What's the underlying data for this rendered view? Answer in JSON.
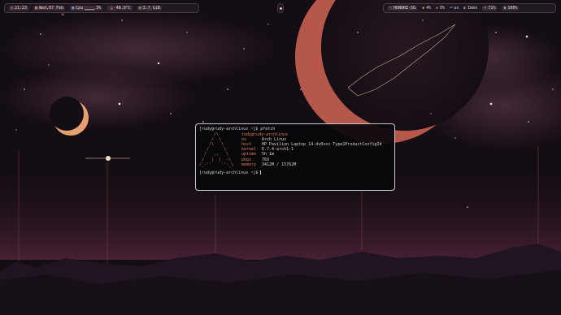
{
  "topbar": {
    "left": {
      "time": "21:23",
      "date": "Wed,07 Feb",
      "cpu_label": "Cpu",
      "cpu_graph": "▁▁▁▁",
      "cpu_percent": "3%",
      "temp": "48.0°C",
      "mem": "3.7 GiB"
    },
    "right": {
      "network": "HONORE-5G",
      "cpu_small": "4%",
      "mem_small": "0%",
      "keyboard": "us",
      "mode": "Immo",
      "brightness": "71%",
      "battery": "100%"
    }
  },
  "icons": {
    "clock": "clock-icon",
    "calendar": "calendar-icon",
    "cpu": "cpu-icon",
    "temperature": "thermometer-icon",
    "memory": "memory-icon",
    "wifi": "wifi-icon",
    "battery": "battery-icon"
  },
  "close_glyph": "×",
  "terminal": {
    "prompt1": "[rudy@rudy-archlinux ~]$ pfetch",
    "logo": "      /\\\n     /  \\\n    /\\   \\\n   /      \\\n  /   ,,   \\\n /   |  |  -\\\n/_-''    ''-_\\",
    "header": "rudy@rudy-archlinux",
    "rows": [
      {
        "key": "os",
        "value": "Arch Linux"
      },
      {
        "key": "host",
        "value": "HP Pavilion Laptop 14-dv0xxx Type1ProductConfigId"
      },
      {
        "key": "kernel",
        "value": "6.7.4-arch1-1"
      },
      {
        "key": "uptime",
        "value": "5h 1m"
      },
      {
        "key": "pkgs",
        "value": "769"
      },
      {
        "key": "memory",
        "value": "3412M / 15762M"
      }
    ],
    "prompt2": "[rudy@rudy-archlinux ~]$ "
  },
  "colors": {
    "sky": "#140d13",
    "mountain": "#1f1420",
    "accent": "#e07a5f",
    "moon_orange": "#b5574a"
  }
}
